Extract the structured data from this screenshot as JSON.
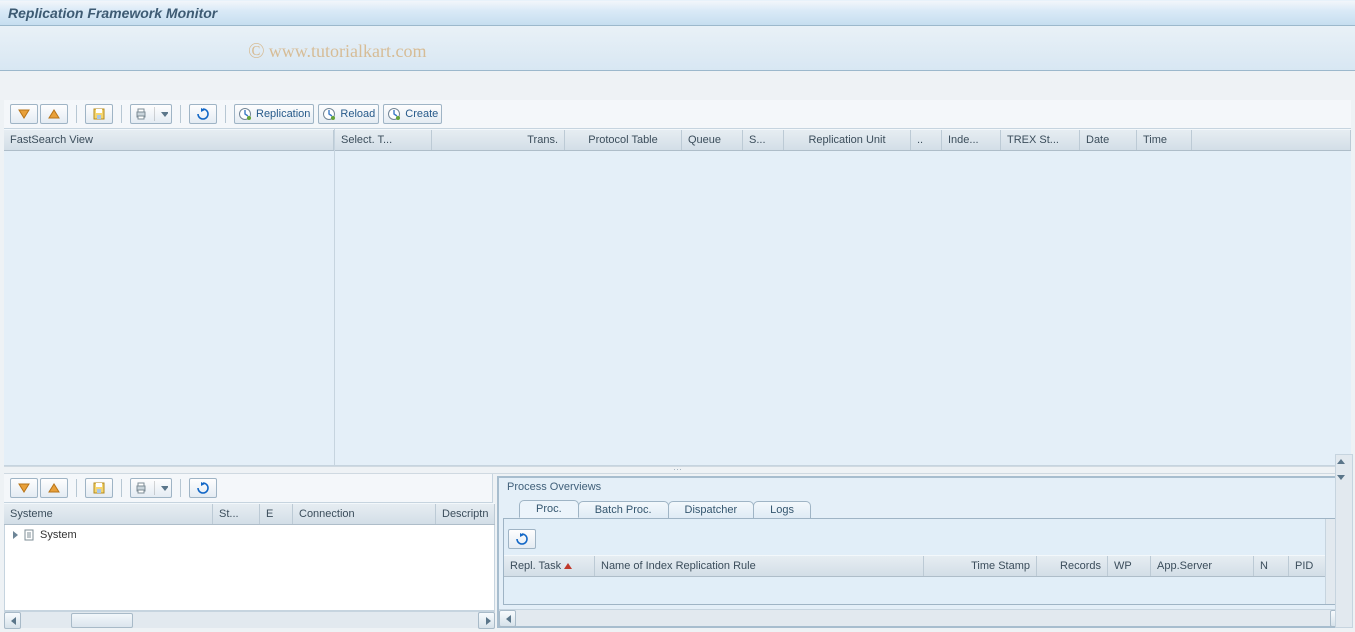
{
  "header": {
    "title": "Replication Framework Monitor"
  },
  "watermark": "www.tutorialkart.com",
  "toolbar_main": {
    "replication_label": "Replication",
    "reload_label": "Reload",
    "create_label": "Create"
  },
  "tree_upper": {
    "header": "FastSearch View"
  },
  "grid_upper": {
    "columns": [
      "Select. T...",
      "Trans.",
      "Protocol Table",
      "Queue",
      "S...",
      "Replication Unit",
      "..",
      "Inde...",
      "TREX St...",
      "Date",
      "Time"
    ]
  },
  "lower_left": {
    "columns": [
      "Systeme",
      "St...",
      "E",
      "Connection",
      "Descriptn"
    ],
    "tree_root": "System"
  },
  "lower_right": {
    "groupbox_title": "Process Overviews",
    "tabs": [
      "Proc.",
      "Batch Proc.",
      "Dispatcher",
      "Logs"
    ],
    "active_tab": 0,
    "proc_columns": [
      "Repl. Task",
      "Name of Index Replication Rule",
      "Time Stamp",
      "Records",
      "WP",
      "App.Server",
      "N",
      "PID"
    ]
  }
}
